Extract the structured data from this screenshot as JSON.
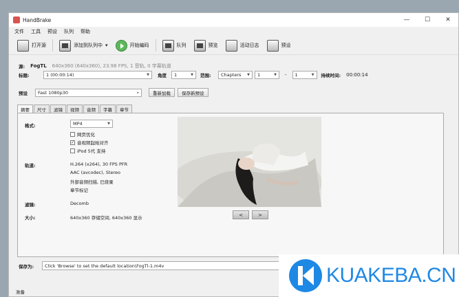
{
  "window": {
    "title": "HandBrake",
    "minimize": "—",
    "maximize": "☐",
    "close": "✕"
  },
  "menu": [
    "文件",
    "工具",
    "预设",
    "队列",
    "帮助"
  ],
  "toolbar": {
    "open": "打开源",
    "add_queue": "添加到队列中",
    "add_queue_arrow": "▾",
    "start": "开始编码",
    "queue": "队列",
    "preview": "预览",
    "activity": "活动日志",
    "presets": "预设"
  },
  "source": {
    "label": "源:",
    "name": "FogTL",
    "info": "640x360 (640x360), 23.98 FPS, 1 音轨, 0 字幕轨道"
  },
  "title_row": {
    "title_label": "标题:",
    "title_value": "1 (00:00:14)",
    "angle_label": "角度",
    "angle_value": "1",
    "range_label": "范围:",
    "range_type": "Chapters",
    "range_start": "1",
    "range_dash": "-",
    "range_end": "1",
    "duration_label": "持续时间:",
    "duration_value": "00:00:14"
  },
  "preset_row": {
    "label": "预设",
    "value": "Fast 1080p30",
    "reload": "重新加载",
    "save_new": "保存新预设"
  },
  "tabs": [
    "摘要",
    "尺寸",
    "滤镜",
    "视频",
    "音频",
    "字幕",
    "章节"
  ],
  "summary": {
    "format_label": "格式:",
    "format_value": "MP4",
    "web_optimized": "网页优化",
    "align_av": "音视频起始对齐",
    "ipod": "iPod 5代 支持",
    "web_checked": false,
    "align_checked": true,
    "ipod_checked": false,
    "tracks_label": "轨道:",
    "tracks": [
      "H.264 (x264), 30 FPS PFR",
      "AAC (avcodec), Stereo",
      "外部音频扫描, 已烧录",
      "章节标记"
    ],
    "filters_label": "滤镜:",
    "filters_value": "Decomb",
    "size_label": "大小:",
    "size_value": "640x360 存储空间, 640x360 显示",
    "prev": "<",
    "next": ">"
  },
  "save": {
    "label": "保存为:",
    "path": "Click 'Browse' to set the default location\\FogTl-1.m4v"
  },
  "status": "准备",
  "watermark": "KUAKEBA.CN"
}
